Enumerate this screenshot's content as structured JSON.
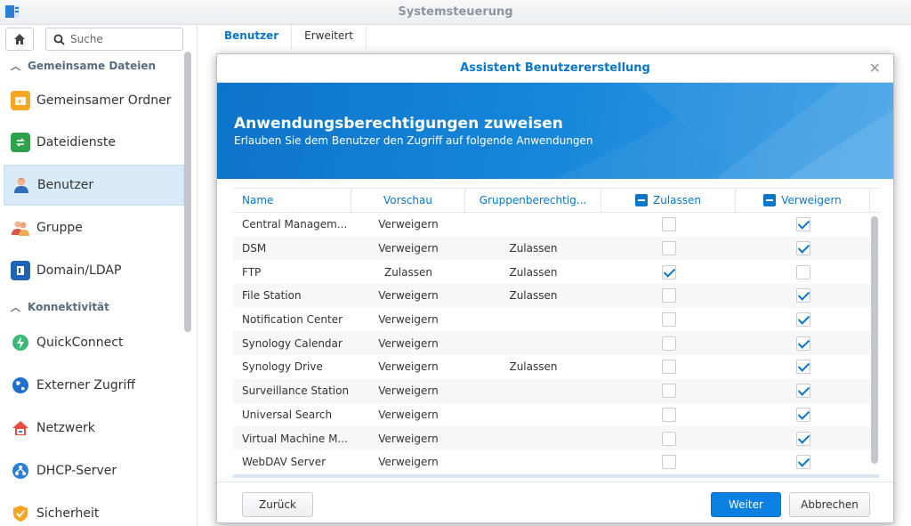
{
  "window": {
    "title": "Systemsteuerung"
  },
  "sidebar": {
    "search_placeholder": "Suche",
    "sections": [
      {
        "label": "Gemeinsame Dateien"
      },
      {
        "label": "Konnektivität"
      }
    ],
    "items": [
      {
        "label": "Gemeinsamer Ordner",
        "icon": "shared-folder-icon"
      },
      {
        "label": "Dateidienste",
        "icon": "file-services-icon"
      },
      {
        "label": "Benutzer",
        "icon": "user-icon",
        "active": true
      },
      {
        "label": "Gruppe",
        "icon": "group-icon"
      },
      {
        "label": "Domain/LDAP",
        "icon": "domain-icon"
      },
      {
        "label": "QuickConnect",
        "icon": "quickconnect-icon"
      },
      {
        "label": "Externer Zugriff",
        "icon": "external-access-icon"
      },
      {
        "label": "Netzwerk",
        "icon": "network-icon"
      },
      {
        "label": "DHCP-Server",
        "icon": "dhcp-server-icon"
      },
      {
        "label": "Sicherheit",
        "icon": "security-icon"
      }
    ]
  },
  "tabs": [
    {
      "label": "Benutzer",
      "active": true
    },
    {
      "label": "Erweitert"
    }
  ],
  "dialog": {
    "title": "Assistent Benutzererstellung",
    "banner_title": "Anwendungsberechtigungen zuweisen",
    "banner_subtitle": "Erlauben Sie dem Benutzer den Zugriff auf folgende Anwendungen",
    "columns": {
      "name": "Name",
      "preview": "Vorschau",
      "group": "Gruppenberechtig...",
      "allow": "Zulassen",
      "deny": "Verweigern"
    },
    "rows": [
      {
        "name": "Central Managem...",
        "preview": "Verweigern",
        "group": "",
        "allow": false,
        "deny": true
      },
      {
        "name": "DSM",
        "preview": "Verweigern",
        "group": "Zulassen",
        "allow": false,
        "deny": true
      },
      {
        "name": "FTP",
        "preview": "Zulassen",
        "group": "Zulassen",
        "allow": true,
        "deny": false
      },
      {
        "name": "File Station",
        "preview": "Verweigern",
        "group": "Zulassen",
        "allow": false,
        "deny": true
      },
      {
        "name": "Notification Center",
        "preview": "Verweigern",
        "group": "",
        "allow": false,
        "deny": true
      },
      {
        "name": "Synology Calendar",
        "preview": "Verweigern",
        "group": "",
        "allow": false,
        "deny": true
      },
      {
        "name": "Synology Drive",
        "preview": "Verweigern",
        "group": "Zulassen",
        "allow": false,
        "deny": true
      },
      {
        "name": "Surveillance Station",
        "preview": "Verweigern",
        "group": "",
        "allow": false,
        "deny": true
      },
      {
        "name": "Universal Search",
        "preview": "Verweigern",
        "group": "",
        "allow": false,
        "deny": true
      },
      {
        "name": "Virtual Machine M...",
        "preview": "Verweigern",
        "group": "",
        "allow": false,
        "deny": true
      },
      {
        "name": "WebDAV Server",
        "preview": "Verweigern",
        "group": "",
        "allow": false,
        "deny": true
      }
    ],
    "buttons": {
      "back": "Zurück",
      "next": "Weiter",
      "cancel": "Abbrechen"
    }
  },
  "colors": {
    "accent": "#0a76c8",
    "banner": "#1585d8",
    "active_nav": "#d9ebf9"
  }
}
